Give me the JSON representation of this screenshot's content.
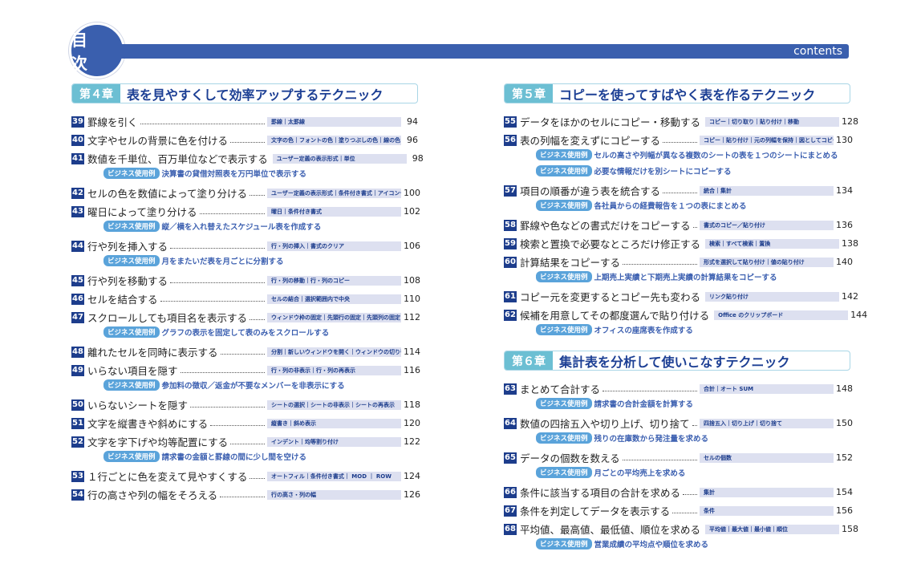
{
  "header": {
    "title": "目 次",
    "subtitle": "contents"
  },
  "biz_label": "ビジネス使用例",
  "columns": [
    {
      "chapters": [
        {
          "label": "第４章",
          "title": "表を見やすくして効率アップするテクニック",
          "entries": [
            {
              "num": "39",
              "title": "罫線を引く",
              "tags": "罫線｜太罫線",
              "page": "94"
            },
            {
              "num": "40",
              "title": "文字やセルの背景に色を付ける",
              "tags": "文字の色｜フォントの色｜塗りつぶしの色｜線の色",
              "page": "96"
            },
            {
              "num": "41",
              "title": "数値を千単位、百万単位などで表示する",
              "tags": "ユーザー定義の表示形式｜単位",
              "page": "98",
              "biz": [
                "決算書の貸借対照表を万円単位で表示する"
              ]
            },
            {
              "num": "42",
              "title": "セルの色を数値によって塗り分ける",
              "tags": "ユーザー定義の表示形式｜条件付き書式｜アイコンセット",
              "page": "100"
            },
            {
              "num": "43",
              "title": "曜日によって塗り分ける",
              "tags": "曜日｜条件付き書式",
              "page": "102",
              "biz": [
                "縦／横を入れ替えたスケジュール表を作成する"
              ]
            },
            {
              "num": "44",
              "title": "行や列を挿入する",
              "tags": "行・列の挿入｜書式のクリア",
              "page": "106",
              "biz": [
                "月をまたいだ表を月ごとに分割する"
              ]
            },
            {
              "num": "45",
              "title": "行や列を移動する",
              "tags": "行・列の移動｜行・列のコピー",
              "page": "108"
            },
            {
              "num": "46",
              "title": "セルを結合する",
              "tags": "セルの結合｜選択範囲内で中央",
              "page": "110"
            },
            {
              "num": "47",
              "title": "スクロールしても項目名を表示する",
              "tags": "ウィンドウ枠の固定｜先頭行の固定｜先頭列の固定",
              "page": "112",
              "biz": [
                "グラフの表示を固定して表のみをスクロールする"
              ]
            },
            {
              "num": "48",
              "title": "離れたセルを同時に表示する",
              "tags": "分割｜新しいウィンドウを開く｜ウィンドウの切り替え",
              "page": "114"
            },
            {
              "num": "49",
              "title": "いらない項目を隠す",
              "tags": "行・列の非表示｜行・列の再表示",
              "page": "116",
              "biz": [
                "参加料の徴収／返金が不要なメンバーを非表示にする"
              ]
            },
            {
              "num": "50",
              "title": "いらないシートを隠す",
              "tags": "シートの選択｜シートの非表示｜シートの再表示",
              "page": "118"
            },
            {
              "num": "51",
              "title": "文字を縦書きや斜めにする",
              "tags": "縦書き｜斜め表示",
              "page": "120"
            },
            {
              "num": "52",
              "title": "文字を字下げや均等配置にする",
              "tags": "インデント｜均等割り付け",
              "page": "122",
              "biz": [
                "請求書の金額と罫線の間に少し間を空ける"
              ]
            },
            {
              "num": "53",
              "title": "１行ごとに色を変えて見やすくする",
              "tags": "オートフィル｜条件付き書式｜ MOD ｜ ROW",
              "page": "124"
            },
            {
              "num": "54",
              "title": "行の高さや列の幅をそろえる",
              "tags": "行の高さ・列の幅",
              "page": "126"
            }
          ]
        }
      ]
    },
    {
      "chapters": [
        {
          "label": "第５章",
          "title": "コピーを使ってすばやく表を作るテクニック",
          "entries": [
            {
              "num": "55",
              "title": "データをほかのセルにコピー・移動する",
              "tags": "コピー｜切り取り｜貼り付け｜移動",
              "page": "128"
            },
            {
              "num": "56",
              "title": "表の列幅を変えずにコピーする",
              "tags": "コピー｜貼り付け｜元の列幅を保持｜図としてコピー",
              "page": "130",
              "biz": [
                "セルの高さや列幅が異なる複数のシートの表を１つのシートにまとめる",
                "必要な情報だけを別シートにコピーする"
              ]
            },
            {
              "num": "57",
              "title": "項目の順番が違う表を統合する",
              "tags": "統合｜集計",
              "page": "134",
              "biz": [
                "各社員からの経費報告を１つの表にまとめる"
              ]
            },
            {
              "num": "58",
              "title": "罫線や色などの書式だけをコピーする",
              "tags": "書式のコピー／貼り付け",
              "page": "136"
            },
            {
              "num": "59",
              "title": "検索と置換で必要なところだけ修正する",
              "tags": "検索｜すべて検索｜置換",
              "page": "138"
            },
            {
              "num": "60",
              "title": "計算結果をコピーする",
              "tags": "形式を選択して貼り付け｜値の貼り付け",
              "page": "140",
              "biz": [
                "上期売上実績と下期売上実績の計算結果をコピーする"
              ]
            },
            {
              "num": "61",
              "title": "コピー元を変更するとコピー先も変わる",
              "tags": "リンク貼り付け",
              "page": "142"
            },
            {
              "num": "62",
              "title": "候補を用意してその都度選んで貼り付ける",
              "tags": "Office のクリップボード",
              "page": "144",
              "biz": [
                "オフィスの座席表を作成する"
              ]
            }
          ]
        },
        {
          "label": "第６章",
          "title": "集計表を分析して使いこなすテクニック",
          "entries": [
            {
              "num": "63",
              "title": "まとめて合計する",
              "tags": "合計｜オート SUM",
              "page": "148",
              "biz": [
                "請求書の合計金額を計算する"
              ]
            },
            {
              "num": "64",
              "title": "数値の四捨五入や切り上げ、切り捨て",
              "tags": "四捨五入｜切り上げ｜切り捨て",
              "page": "150",
              "biz": [
                "残りの在庫数から発注量を求める"
              ]
            },
            {
              "num": "65",
              "title": "データの個数を数える",
              "tags": "セルの個数",
              "page": "152",
              "biz": [
                "月ごとの平均売上を求める"
              ]
            },
            {
              "num": "66",
              "title": "条件に該当する項目の合計を求める",
              "tags": "集計",
              "page": "154"
            },
            {
              "num": "67",
              "title": "条件を判定してデータを表示する",
              "tags": "条件",
              "page": "156"
            },
            {
              "num": "68",
              "title": "平均値、最高値、最低値、順位を求める",
              "tags": "平均値｜最大値｜最小値｜順位",
              "page": "158",
              "biz": [
                "営業成績の平均点や順位を求める"
              ]
            }
          ]
        }
      ]
    }
  ]
}
